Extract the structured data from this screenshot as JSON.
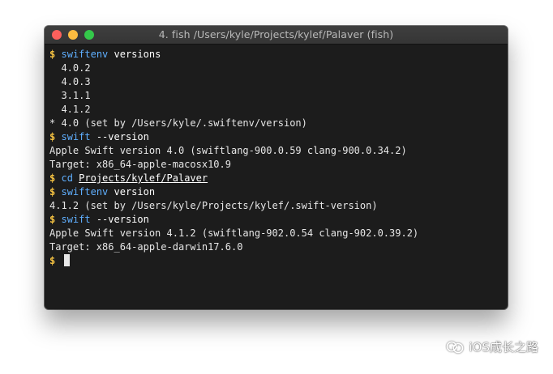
{
  "window": {
    "title": "4. fish  /Users/kyle/Projects/kylef/Palaver (fish)"
  },
  "terminal": {
    "prompt": "$",
    "lines": [
      {
        "kind": "cmd",
        "cmd": "swiftenv",
        "args": " versions"
      },
      {
        "kind": "out",
        "text": "  4.0.2"
      },
      {
        "kind": "out",
        "text": "  4.0.3"
      },
      {
        "kind": "out",
        "text": "  3.1.1"
      },
      {
        "kind": "out",
        "text": "  4.1.2"
      },
      {
        "kind": "out",
        "text": "* 4.0 (set by /Users/kyle/.swiftenv/version)"
      },
      {
        "kind": "cmd",
        "cmd": "swift",
        "args": " --version"
      },
      {
        "kind": "out",
        "text": "Apple Swift version 4.0 (swiftlang-900.0.59 clang-900.0.34.2)"
      },
      {
        "kind": "out",
        "text": "Target: x86_64-apple-macosx10.9"
      },
      {
        "kind": "cmd",
        "cmd": "cd",
        "path": "Projects/kylef/Palaver"
      },
      {
        "kind": "cmd",
        "cmd": "swiftenv",
        "args": " version"
      },
      {
        "kind": "out",
        "text": "4.1.2 (set by /Users/kyle/Projects/kylef/.swift-version)"
      },
      {
        "kind": "cmd",
        "cmd": "swift",
        "args": " --version"
      },
      {
        "kind": "out",
        "text": "Apple Swift version 4.1.2 (swiftlang-902.0.54 clang-902.0.39.2)"
      },
      {
        "kind": "out",
        "text": "Target: x86_64-apple-darwin17.6.0"
      },
      {
        "kind": "cursor"
      }
    ]
  },
  "watermark": {
    "text": "iOS成长之路",
    "icon": "wechat-official-account-icon"
  },
  "colors": {
    "prompt": "#f5c242",
    "command": "#5fafff",
    "output": "#e6e6e6",
    "background": "#1c1c1c"
  }
}
